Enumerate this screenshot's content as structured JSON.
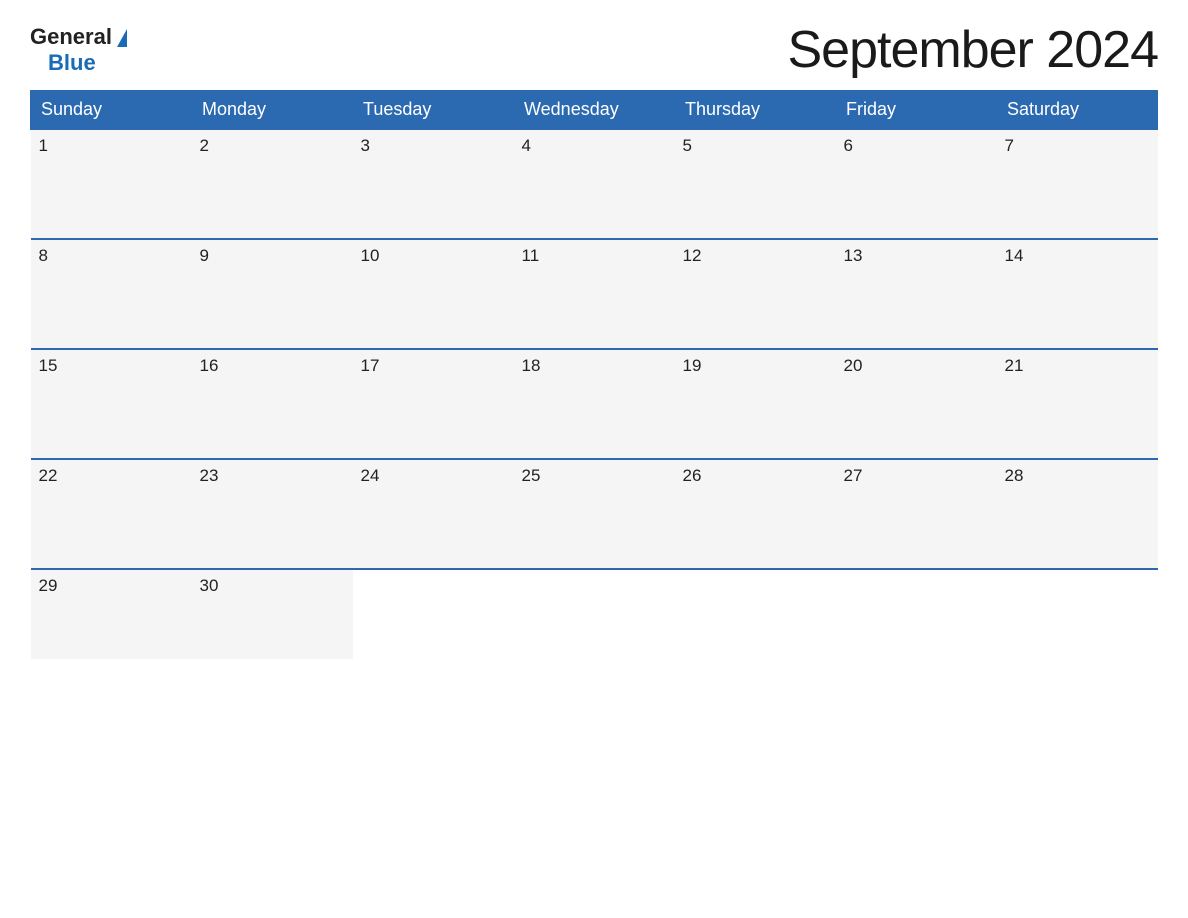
{
  "logo": {
    "general_text": "General",
    "blue_text": "Blue"
  },
  "title": "September 2024",
  "days_of_week": [
    "Sunday",
    "Monday",
    "Tuesday",
    "Wednesday",
    "Thursday",
    "Friday",
    "Saturday"
  ],
  "weeks": [
    [
      {
        "date": "1",
        "empty": false
      },
      {
        "date": "2",
        "empty": false
      },
      {
        "date": "3",
        "empty": false
      },
      {
        "date": "4",
        "empty": false
      },
      {
        "date": "5",
        "empty": false
      },
      {
        "date": "6",
        "empty": false
      },
      {
        "date": "7",
        "empty": false
      }
    ],
    [
      {
        "date": "8",
        "empty": false
      },
      {
        "date": "9",
        "empty": false
      },
      {
        "date": "10",
        "empty": false
      },
      {
        "date": "11",
        "empty": false
      },
      {
        "date": "12",
        "empty": false
      },
      {
        "date": "13",
        "empty": false
      },
      {
        "date": "14",
        "empty": false
      }
    ],
    [
      {
        "date": "15",
        "empty": false
      },
      {
        "date": "16",
        "empty": false
      },
      {
        "date": "17",
        "empty": false
      },
      {
        "date": "18",
        "empty": false
      },
      {
        "date": "19",
        "empty": false
      },
      {
        "date": "20",
        "empty": false
      },
      {
        "date": "21",
        "empty": false
      }
    ],
    [
      {
        "date": "22",
        "empty": false
      },
      {
        "date": "23",
        "empty": false
      },
      {
        "date": "24",
        "empty": false
      },
      {
        "date": "25",
        "empty": false
      },
      {
        "date": "26",
        "empty": false
      },
      {
        "date": "27",
        "empty": false
      },
      {
        "date": "28",
        "empty": false
      }
    ],
    [
      {
        "date": "29",
        "empty": false
      },
      {
        "date": "30",
        "empty": false
      },
      {
        "date": "",
        "empty": true
      },
      {
        "date": "",
        "empty": true
      },
      {
        "date": "",
        "empty": true
      },
      {
        "date": "",
        "empty": true
      },
      {
        "date": "",
        "empty": true
      }
    ]
  ],
  "colors": {
    "header_bg": "#2b6ab1",
    "header_text": "#ffffff",
    "cell_bg": "#f5f5f5",
    "empty_bg": "#ffffff",
    "border": "#2b6ab1",
    "title_color": "#1a1a1a",
    "day_number": "#222222"
  }
}
